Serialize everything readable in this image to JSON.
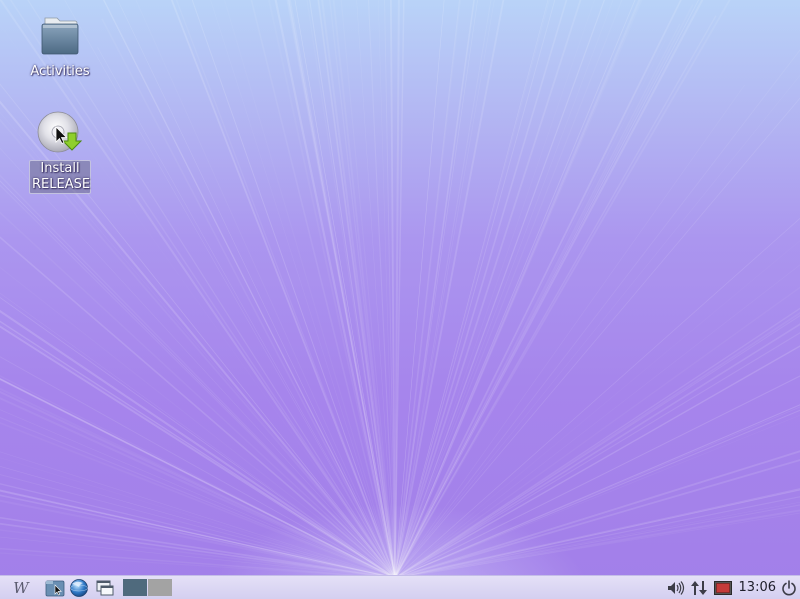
{
  "desktop": {
    "icons": [
      {
        "label": "Activities",
        "icon": "folder-icon"
      },
      {
        "label": "Install RELEASE",
        "icon": "install-disc-icon",
        "selected": true
      }
    ]
  },
  "panel": {
    "menu_glyph": "W",
    "launchers": [
      "file-manager-icon",
      "web-browser-icon",
      "show-desktop-icon"
    ],
    "workspaces": [
      {
        "name": "workspace-1",
        "active": true,
        "color": "#4f6a7d"
      },
      {
        "name": "workspace-2",
        "active": false,
        "color": "#a3a3a3"
      }
    ],
    "tray": [
      "volume-icon",
      "network-icon",
      "red-indicator-icon"
    ],
    "clock": "13:06",
    "power_icon": "power-icon"
  },
  "colors": {
    "wallpaper_top": "#b9d3f8",
    "wallpaper_bottom": "#a27fe9",
    "panel_bg": "#dcd8f3"
  }
}
